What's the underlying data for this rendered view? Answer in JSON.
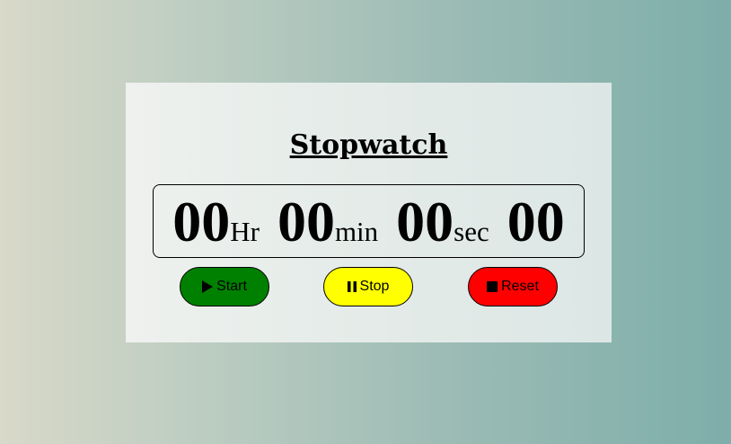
{
  "title": "Stopwatch",
  "display": {
    "hours": "00",
    "hours_unit": "Hr",
    "minutes": "00",
    "minutes_unit": "min",
    "seconds": "00",
    "seconds_unit": "sec",
    "milliseconds": "00"
  },
  "buttons": {
    "start": {
      "label": "Start",
      "icon": "play-icon",
      "color": "#008000"
    },
    "stop": {
      "label": "Stop",
      "icon": "pause-icon",
      "color": "#ffff00"
    },
    "reset": {
      "label": "Reset",
      "icon": "stop-icon",
      "color": "#ff0000"
    }
  }
}
